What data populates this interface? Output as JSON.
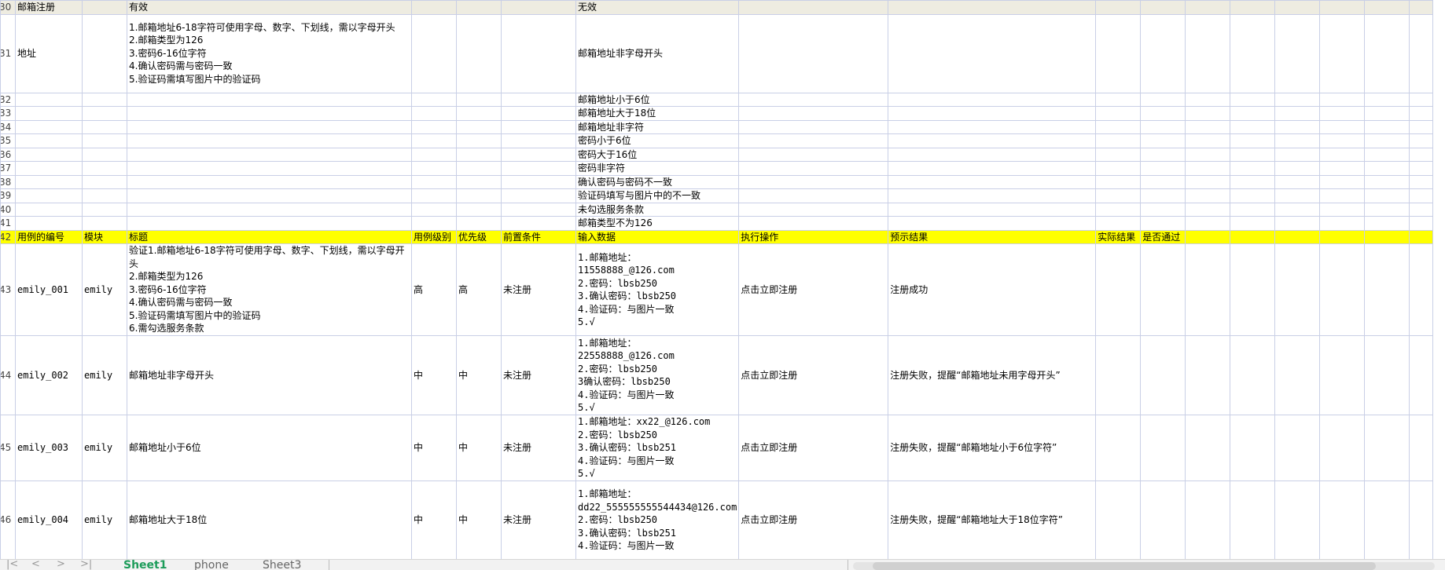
{
  "rows": [
    {
      "num": "30",
      "cells": [
        "邮箱注册",
        "",
        "有效",
        "",
        "",
        "",
        "无效",
        "",
        "",
        "",
        "",
        "",
        "",
        "",
        "",
        "",
        ""
      ]
    },
    {
      "num": "31",
      "cells": [
        "地址",
        "",
        "1.邮箱地址6-18字符可使用字母、数字、下划线，需以字母开头\n2.邮箱类型为126\n3.密码6-16位字符\n4.确认密码需与密码一致\n5.验证码需填写图片中的验证码",
        "",
        "",
        "",
        "邮箱地址非字母开头",
        "",
        "",
        "",
        "",
        "",
        "",
        "",
        "",
        "",
        ""
      ]
    },
    {
      "num": "32",
      "cells": [
        "",
        "",
        "",
        "",
        "",
        "",
        "邮箱地址小于6位",
        "",
        "",
        "",
        "",
        "",
        "",
        "",
        "",
        "",
        ""
      ]
    },
    {
      "num": "33",
      "cells": [
        "",
        "",
        "",
        "",
        "",
        "",
        "邮箱地址大于18位",
        "",
        "",
        "",
        "",
        "",
        "",
        "",
        "",
        "",
        ""
      ]
    },
    {
      "num": "34",
      "cells": [
        "",
        "",
        "",
        "",
        "",
        "",
        "邮箱地址非字符",
        "",
        "",
        "",
        "",
        "",
        "",
        "",
        "",
        "",
        ""
      ]
    },
    {
      "num": "35",
      "cells": [
        "",
        "",
        "",
        "",
        "",
        "",
        "密码小于6位",
        "",
        "",
        "",
        "",
        "",
        "",
        "",
        "",
        "",
        ""
      ]
    },
    {
      "num": "36",
      "cells": [
        "",
        "",
        "",
        "",
        "",
        "",
        "密码大于16位",
        "",
        "",
        "",
        "",
        "",
        "",
        "",
        "",
        "",
        ""
      ]
    },
    {
      "num": "37",
      "cells": [
        "",
        "",
        "",
        "",
        "",
        "",
        "密码非字符",
        "",
        "",
        "",
        "",
        "",
        "",
        "",
        "",
        "",
        ""
      ]
    },
    {
      "num": "38",
      "cells": [
        "",
        "",
        "",
        "",
        "",
        "",
        "确认密码与密码不一致",
        "",
        "",
        "",
        "",
        "",
        "",
        "",
        "",
        "",
        ""
      ]
    },
    {
      "num": "39",
      "cells": [
        "",
        "",
        "",
        "",
        "",
        "",
        "验证码填写与图片中的不一致",
        "",
        "",
        "",
        "",
        "",
        "",
        "",
        "",
        "",
        ""
      ]
    },
    {
      "num": "40",
      "cells": [
        "",
        "",
        "",
        "",
        "",
        "",
        "未勾选服务条款",
        "",
        "",
        "",
        "",
        "",
        "",
        "",
        "",
        "",
        ""
      ]
    },
    {
      "num": "41",
      "cells": [
        "",
        "",
        "",
        "",
        "",
        "",
        "邮箱类型不为126",
        "",
        "",
        "",
        "",
        "",
        "",
        "",
        "",
        "",
        ""
      ]
    },
    {
      "num": "42",
      "cells": [
        "用例的编号",
        "模块",
        "标题",
        "用例级别",
        "优先级",
        "前置条件",
        "输入数据",
        "执行操作",
        "预示结果",
        "实际结果",
        "是否通过",
        "",
        "",
        "",
        "",
        "",
        ""
      ]
    },
    {
      "num": "43",
      "cells": [
        "emily_001",
        "emily",
        "验证1.邮箱地址6-18字符可使用字母、数字、下划线，需以字母开头\n2.邮箱类型为126\n3.密码6-16位字符\n4.确认密码需与密码一致\n5.验证码需填写图片中的验证码\n6.需勾选服务条款",
        "高",
        "高",
        "未注册",
        "1.邮箱地址：\n11558888_@126.com\n2.密码：lbsb250\n3.确认密码：lbsb250\n4.验证码：与图片一致\n5.√",
        "点击立即注册",
        "注册成功",
        "",
        "",
        "",
        "",
        "",
        "",
        "",
        ""
      ]
    },
    {
      "num": "44",
      "cells": [
        "emily_002",
        "emily",
        "邮箱地址非字母开头",
        "中",
        "中",
        "未注册",
        "1.邮箱地址：\n22558888_@126.com\n2.密码：lbsb250\n3确认密码：lbsb250\n4.验证码：与图片一致\n5.√",
        "点击立即注册",
        "注册失败，提醒“邮箱地址未用字母开头”",
        "",
        "",
        "",
        "",
        "",
        "",
        "",
        ""
      ]
    },
    {
      "num": "45",
      "cells": [
        "emily_003",
        "emily",
        "邮箱地址小于6位",
        "中",
        "中",
        "未注册",
        "1.邮箱地址：xx22_@126.com\n2.密码：lbsb250\n3.确认密码：lbsb251\n4.验证码：与图片一致\n5.√",
        "点击立即注册",
        "注册失败，提醒“邮箱地址小于6位字符”",
        "",
        "",
        "",
        "",
        "",
        "",
        "",
        ""
      ]
    },
    {
      "num": "46",
      "cells": [
        "emily_004",
        "emily",
        "邮箱地址大于18位",
        "中",
        "中",
        "未注册",
        "1.邮箱地址：\ndd22_555555555544434@126.com\n2.密码：lbsb250\n3.确认密码：lbsb251\n4.验证码：与图片一致",
        "点击立即注册",
        "注册失败，提醒“邮箱地址大于18位字符”",
        "",
        "",
        "",
        "",
        "",
        "",
        "",
        ""
      ]
    }
  ],
  "sheet_tabs": [
    "Sheet1",
    "phone",
    "Sheet3"
  ],
  "colors": {
    "header_row": "#ffff00",
    "section_row": "#eeece1",
    "gridline": "#c9cfe6",
    "active_tab": "#1d9c5a"
  }
}
